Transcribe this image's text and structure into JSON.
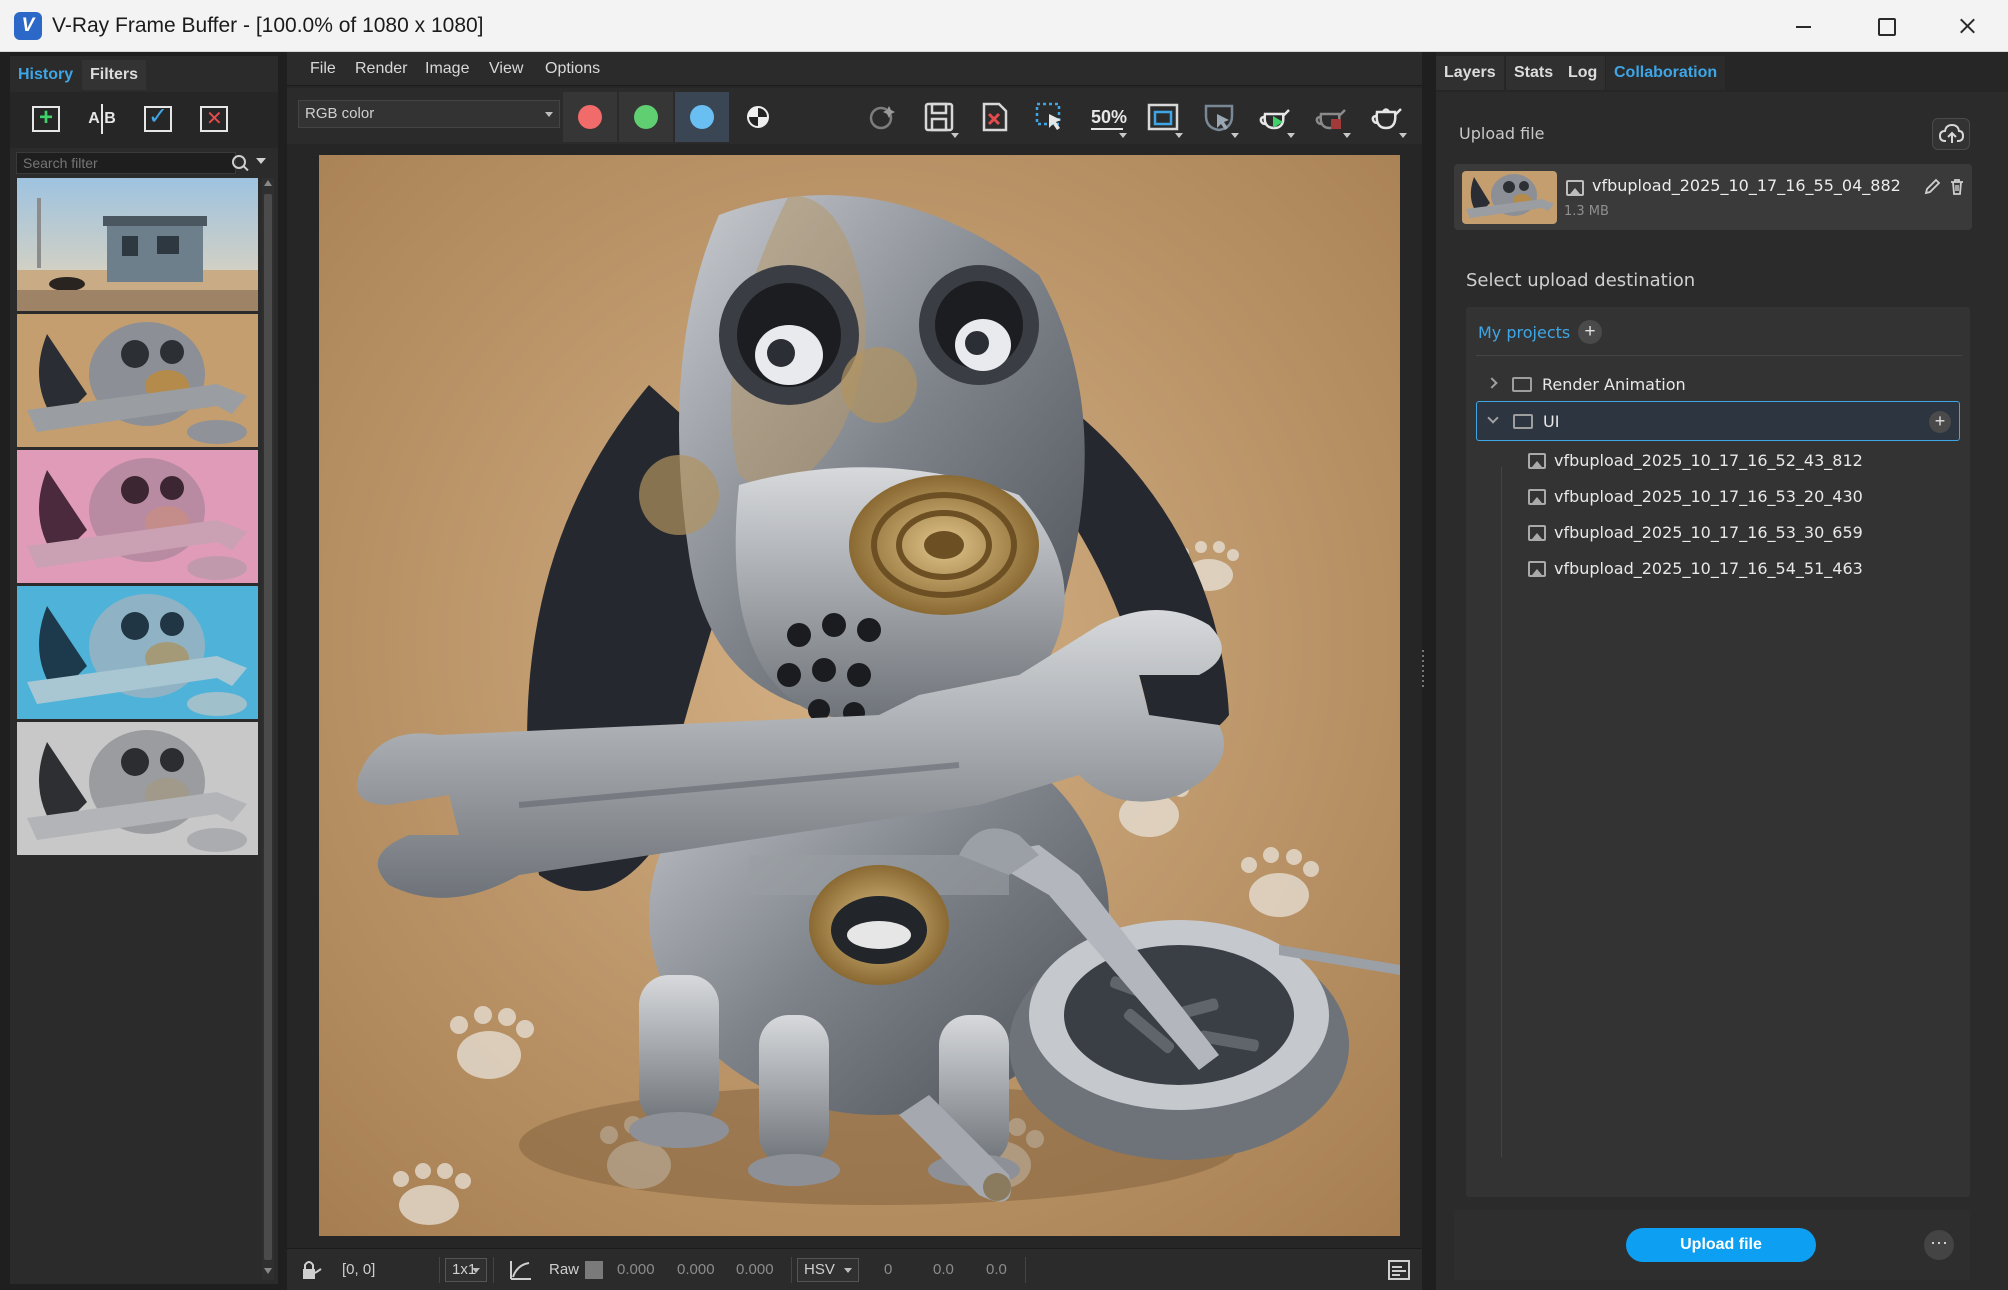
{
  "window": {
    "title": "V-Ray Frame Buffer - [100.0% of 1080 x 1080]"
  },
  "left_panel": {
    "tabs": [
      "History",
      "Filters"
    ],
    "toolbar_ab_label": "A|B",
    "search_placeholder": "Search filter",
    "history_count": 5
  },
  "menu": [
    "File",
    "Render",
    "Image",
    "View",
    "Options"
  ],
  "toolbar": {
    "channel_value": "RGB color",
    "zoom_label": "50%"
  },
  "colors": {
    "accent": "#3ea6e6",
    "red_channel": "#f26b6b",
    "green_channel": "#5fcf72",
    "blue_channel": "#69bff1",
    "upload_button": "#0d9ff2"
  },
  "status_bar": {
    "coords": "[0, 0]",
    "sample_size": "1x1",
    "raw_label": "Raw",
    "raw_values": [
      "0.000",
      "0.000",
      "0.000"
    ],
    "color_mode": "HSV",
    "hsv_values": [
      "0",
      "0.0",
      "0.0"
    ]
  },
  "right_panel": {
    "tabs": [
      "Layers",
      "Stats",
      "Log",
      "Collaboration"
    ],
    "active_tab": "Collaboration",
    "upload_label": "Upload file",
    "file": {
      "name": "vfbupload_2025_10_17_16_55_04_882",
      "size": "1.3 MB"
    },
    "destination_label": "Select upload destination",
    "projects_tab": "My projects",
    "folders": [
      {
        "name": "Render Animation",
        "expanded": false
      },
      {
        "name": "UI",
        "expanded": true
      }
    ],
    "files": [
      "vfbupload_2025_10_17_16_52_43_812",
      "vfbupload_2025_10_17_16_53_20_430",
      "vfbupload_2025_10_17_16_53_30_659",
      "vfbupload_2025_10_17_16_54_51_463"
    ],
    "upload_button": "Upload file",
    "more_label": "···"
  },
  "icons": {
    "history_toolbar": [
      "add-history-icon",
      "ab-compare-icon",
      "apply-history-icon",
      "remove-history-icon"
    ],
    "main_toolbar": [
      "ai-enhance-icon",
      "save-image-icon",
      "clear-image-icon",
      "region-render-icon",
      "zoom-icon",
      "frame-icon",
      "lens-effects-icon",
      "start-render-icon",
      "stop-render-icon",
      "teapot-icon"
    ]
  }
}
